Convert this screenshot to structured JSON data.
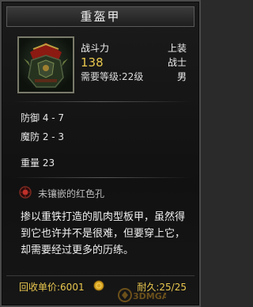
{
  "window": {
    "title": "重盔甲"
  },
  "item": {
    "power_label": "战斗力",
    "power_value": "138",
    "level_requirement": "需要等级:22级",
    "slot": "上装",
    "class": "战士",
    "gender": "男",
    "icon": "armor-icon"
  },
  "stats": {
    "defense": "防御 4 - 7",
    "magic_defense": "魔防 2 - 3",
    "weight": "重量 23"
  },
  "socket": {
    "icon": "red-gem-icon",
    "label": "未镶嵌的红色孔"
  },
  "description": "掺以重铁打造的肌肉型板甲，虽然得到它也许并不是很难，但要穿上它，却需要经过更多的历练。",
  "footer": {
    "price_label": "回收单价:6001",
    "price_icon": "gold-coin-icon",
    "durability": "耐久:25/25"
  },
  "watermark": {
    "text": "3DMGAME"
  },
  "colors": {
    "gold": "#e9c74e",
    "text": "#f0f0f0",
    "panel_bg": "#141414"
  }
}
